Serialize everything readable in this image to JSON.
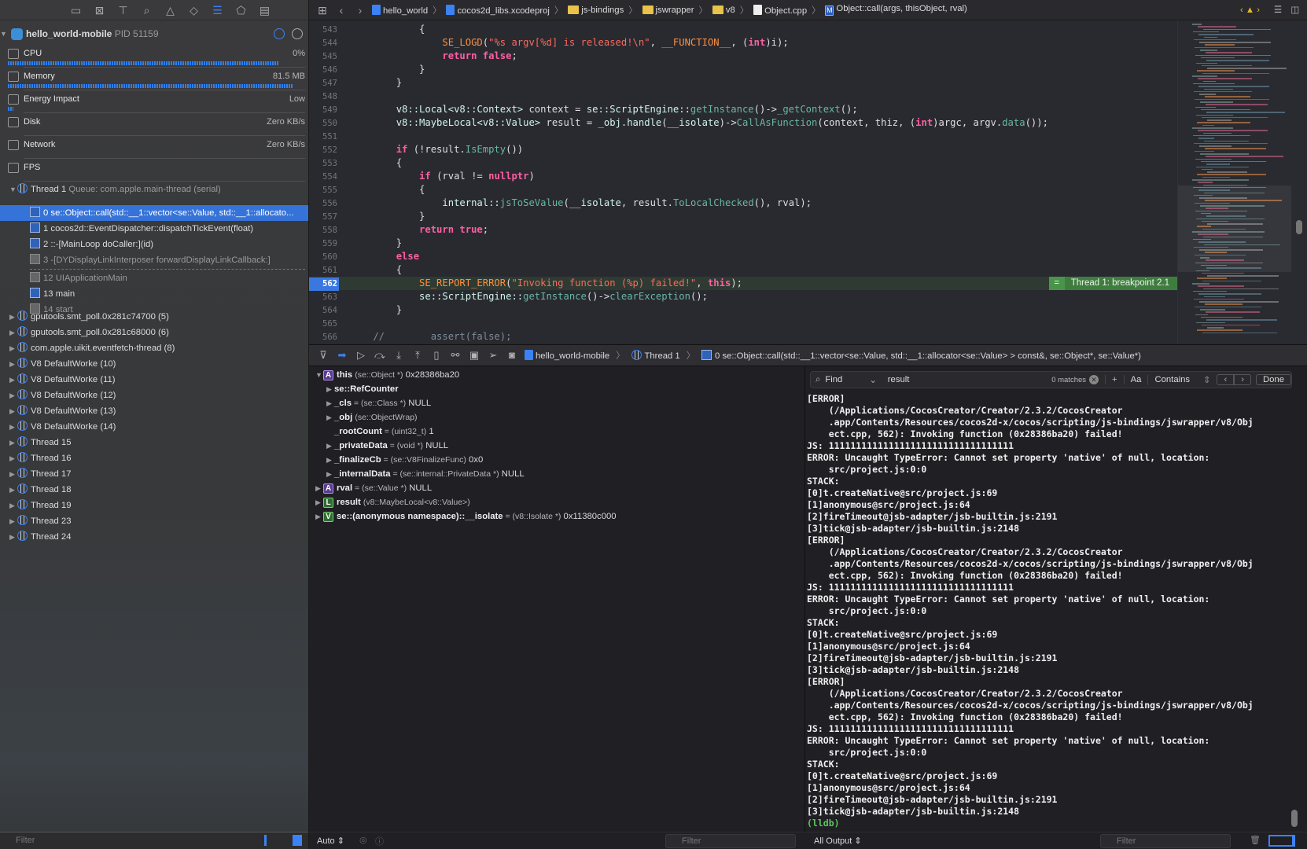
{
  "navigator": {
    "toolbar_icons": [
      "folder-icon",
      "source-control-icon",
      "hierarchy-icon",
      "search-icon",
      "warning-icon",
      "breakpoint-diamond-icon",
      "debug-navigator-icon",
      "tag-icon",
      "report-icon"
    ],
    "process": {
      "name": "hello_world-mobile",
      "pid": "PID 51159"
    },
    "gauges": [
      {
        "label": "CPU",
        "value": "0%",
        "level": 0.93
      },
      {
        "label": "Memory",
        "value": "81.5 MB",
        "level": 0.98
      },
      {
        "label": "Energy Impact",
        "value": "Low",
        "level": 0.02
      },
      {
        "label": "Disk",
        "value": "Zero KB/s"
      },
      {
        "label": "Network",
        "value": "Zero KB/s"
      },
      {
        "label": "FPS",
        "value": ""
      }
    ],
    "thread1": {
      "name": "Thread 1",
      "queue": "Queue: com.apple.main-thread (serial)"
    },
    "frames": [
      {
        "label": "0 se::Object::call(std::__1::vector<se::Value, std::__1::allocato...",
        "kind": "user",
        "selected": true
      },
      {
        "label": "1 cocos2d::EventDispatcher::dispatchTickEvent(float)",
        "kind": "user"
      },
      {
        "label": "2 ::-[MainLoop doCaller:](id)",
        "kind": "user"
      },
      {
        "label": "3 -[DYDisplayLinkInterposer forwardDisplayLinkCallback:]",
        "kind": "system"
      },
      {
        "label": "12 UIApplicationMain",
        "kind": "system"
      },
      {
        "label": "13 main",
        "kind": "user"
      },
      {
        "label": "14 start",
        "kind": "system"
      }
    ],
    "threads": [
      "gputools.smt_poll.0x281c74700 (5)",
      "gputools.smt_poll.0x281c68000 (6)",
      "com.apple.uikit.eventfetch-thread (8)",
      "V8 DefaultWorke (10)",
      "V8 DefaultWorke (11)",
      "V8 DefaultWorke (12)",
      "V8 DefaultWorke (13)",
      "V8 DefaultWorke (14)",
      "Thread 15",
      "Thread 16",
      "Thread 17",
      "Thread 18",
      "Thread 19",
      "Thread 23",
      "Thread 24"
    ],
    "filter_placeholder": "Filter"
  },
  "jumpbar": {
    "crumbs": [
      {
        "label": "hello_world",
        "icon": "project-icon"
      },
      {
        "label": "cocos2d_libs.xcodeproj",
        "icon": "project-icon"
      },
      {
        "label": "js-bindings",
        "icon": "folder-icon"
      },
      {
        "label": "jswrapper",
        "icon": "folder-icon"
      },
      {
        "label": "v8",
        "icon": "folder-icon"
      },
      {
        "label": "Object.cpp",
        "icon": "cpp-file-icon"
      },
      {
        "label": "Object::call(args, thisObject, rval)",
        "icon": "method-icon"
      }
    ]
  },
  "editor": {
    "current_line": 562,
    "breakpoint_label": "Thread 1: breakpoint 2.1",
    "lines": [
      {
        "n": 543,
        "t": [
          [
            "pl",
            "            {"
          ]
        ]
      },
      {
        "n": 544,
        "t": [
          [
            "mac",
            "                SE_LOGD"
          ],
          [
            "pl",
            "("
          ],
          [
            "str",
            "\"%s argv[%d] is released!\\n\""
          ],
          [
            "pl",
            ", "
          ],
          [
            "mac",
            "__FUNCTION__"
          ],
          [
            "pl",
            ", ("
          ],
          [
            "kw",
            "int"
          ],
          [
            "pl",
            ")i);"
          ]
        ]
      },
      {
        "n": 545,
        "t": [
          [
            "kw",
            "                return false"
          ],
          [
            "pl",
            ";"
          ]
        ]
      },
      {
        "n": 546,
        "t": [
          [
            "pl",
            "            }"
          ]
        ]
      },
      {
        "n": 547,
        "t": [
          [
            "pl",
            "        }"
          ]
        ]
      },
      {
        "n": 548,
        "t": []
      },
      {
        "n": 549,
        "t": [
          [
            "ty",
            "        v8::Local<v8::Context>"
          ],
          [
            "pl",
            " context = "
          ],
          [
            "ty",
            "se::ScriptEngine::"
          ],
          [
            "fn",
            "getInstance"
          ],
          [
            "pl",
            "()->"
          ],
          [
            "fn",
            "_getContext"
          ],
          [
            "pl",
            "();"
          ]
        ]
      },
      {
        "n": 550,
        "t": [
          [
            "ty",
            "        v8::MaybeLocal<v8::Value>"
          ],
          [
            "pl",
            " result = "
          ],
          [
            "ty",
            "_obj"
          ],
          [
            "pl",
            "."
          ],
          [
            "ty",
            "handle"
          ],
          [
            "pl",
            "("
          ],
          [
            "ty",
            "__isolate"
          ],
          [
            "pl",
            ")->"
          ],
          [
            "fn",
            "CallAsFunction"
          ],
          [
            "pl",
            "(context, thiz, ("
          ],
          [
            "kw",
            "int"
          ],
          [
            "pl",
            ")argc, argv."
          ],
          [
            "fn",
            "data"
          ],
          [
            "pl",
            "());"
          ]
        ]
      },
      {
        "n": 551,
        "t": []
      },
      {
        "n": 552,
        "t": [
          [
            "kw",
            "        if"
          ],
          [
            "pl",
            " (!result."
          ],
          [
            "fn",
            "IsEmpty"
          ],
          [
            "pl",
            "())"
          ]
        ]
      },
      {
        "n": 553,
        "t": [
          [
            "pl",
            "        {"
          ]
        ]
      },
      {
        "n": 554,
        "t": [
          [
            "kw",
            "            if"
          ],
          [
            "pl",
            " (rval != "
          ],
          [
            "kw",
            "nullptr"
          ],
          [
            "pl",
            ")"
          ]
        ]
      },
      {
        "n": 555,
        "t": [
          [
            "pl",
            "            {"
          ]
        ]
      },
      {
        "n": 556,
        "t": [
          [
            "ty",
            "                internal::"
          ],
          [
            "fn",
            "jsToSeValue"
          ],
          [
            "pl",
            "("
          ],
          [
            "ty",
            "__isolate"
          ],
          [
            "pl",
            ", result."
          ],
          [
            "fn",
            "ToLocalChecked"
          ],
          [
            "pl",
            "(), rval);"
          ]
        ]
      },
      {
        "n": 557,
        "t": [
          [
            "pl",
            "            }"
          ]
        ]
      },
      {
        "n": 558,
        "t": [
          [
            "kw",
            "            return true"
          ],
          [
            "pl",
            ";"
          ]
        ]
      },
      {
        "n": 559,
        "t": [
          [
            "pl",
            "        }"
          ]
        ]
      },
      {
        "n": 560,
        "t": [
          [
            "kw",
            "        else"
          ]
        ]
      },
      {
        "n": 561,
        "t": [
          [
            "pl",
            "        {"
          ]
        ]
      },
      {
        "n": 562,
        "t": [
          [
            "mac",
            "            SE_REPORT_ERROR"
          ],
          [
            "pl",
            "("
          ],
          [
            "str",
            "\"Invoking function (%p) failed!\""
          ],
          [
            "pl",
            ", "
          ],
          [
            "kw",
            "this"
          ],
          [
            "pl",
            ");"
          ]
        ]
      },
      {
        "n": 563,
        "t": [
          [
            "ty",
            "            se::ScriptEngine::"
          ],
          [
            "fn",
            "getInstance"
          ],
          [
            "pl",
            "()->"
          ],
          [
            "fn",
            "clearException"
          ],
          [
            "pl",
            "();"
          ]
        ]
      },
      {
        "n": 564,
        "t": [
          [
            "pl",
            "        }"
          ]
        ]
      },
      {
        "n": 565,
        "t": []
      },
      {
        "n": 566,
        "t": [
          [
            "cm",
            "    //        assert(false);"
          ]
        ]
      }
    ]
  },
  "debugbar": {
    "icons": [
      "hide-debug-area-icon",
      "breakpoints-toggle-icon",
      "continue-icon",
      "step-over-icon",
      "step-into-icon",
      "step-out-icon",
      "view-debugger-icon",
      "memory-graph-icon",
      "environment-overrides-icon",
      "location-icon",
      "camera-icon"
    ],
    "process": "hello_world-mobile",
    "thread": "Thread 1",
    "frame": "0 se::Object::call(std::__1::vector<se::Value, std::__1::allocator<se::Value> > const&, se::Object*, se::Value*)"
  },
  "variables": [
    {
      "depth": 0,
      "exp": "open",
      "badge": "A",
      "name": "this",
      "type": "(se::Object *)",
      "value": "0x28386ba20"
    },
    {
      "depth": 1,
      "exp": "closed",
      "name": "se::RefCounter",
      "type": "",
      "value": ""
    },
    {
      "depth": 1,
      "exp": "closed",
      "name": "_cls",
      "eq": true,
      "type": "(se::Class *)",
      "value": "NULL"
    },
    {
      "depth": 1,
      "exp": "closed",
      "name": "_obj",
      "type": "(se::ObjectWrap)",
      "value": ""
    },
    {
      "depth": 1,
      "exp": "none",
      "name": "_rootCount",
      "eq": true,
      "type": "(uint32_t)",
      "value": "1"
    },
    {
      "depth": 1,
      "exp": "closed",
      "name": "_privateData",
      "eq": true,
      "type": "(void *)",
      "value": "NULL"
    },
    {
      "depth": 1,
      "exp": "closed",
      "name": "_finalizeCb",
      "eq": true,
      "type": "(se::V8FinalizeFunc)",
      "value": "0x0"
    },
    {
      "depth": 1,
      "exp": "closed",
      "name": "_internalData",
      "eq": true,
      "type": "(se::internal::PrivateData *)",
      "value": "NULL"
    },
    {
      "depth": 0,
      "exp": "closed",
      "badge": "A",
      "name": "rval",
      "eq": true,
      "type": "(se::Value *)",
      "value": "NULL"
    },
    {
      "depth": 0,
      "exp": "closed",
      "badge": "L",
      "name": "result",
      "type": "(v8::MaybeLocal<v8::Value>)",
      "value": ""
    },
    {
      "depth": 0,
      "exp": "closed",
      "badge": "V",
      "name": "se::(anonymous namespace)::__isolate",
      "eq": true,
      "type": "(v8::Isolate *)",
      "value": "0x11380c000"
    }
  ],
  "find": {
    "mode": "Find",
    "query": "result",
    "matches": "0 matches",
    "case_label": "Aa",
    "match_type": "Contains",
    "done": "Done"
  },
  "console": {
    "lines": [
      "[ERROR]",
      "    (/Applications/CocosCreator/Creator/2.3.2/CocosCreator",
      "    .app/Contents/Resources/cocos2d-x/cocos/scripting/js-bindings/jswrapper/v8/Obj",
      "    ect.cpp, 562): Invoking function (0x28386ba20) failed!",
      "JS: 1111111111111111111111111111111111",
      "ERROR: Uncaught TypeError: Cannot set property 'native' of null, location:",
      "    src/project.js:0:0",
      "STACK:",
      "[0]t.createNative@src/project.js:69",
      "[1]anonymous@src/project.js:64",
      "[2]fireTimeout@jsb-adapter/jsb-builtin.js:2191",
      "[3]tick@jsb-adapter/jsb-builtin.js:2148",
      "[ERROR]",
      "    (/Applications/CocosCreator/Creator/2.3.2/CocosCreator",
      "    .app/Contents/Resources/cocos2d-x/cocos/scripting/js-bindings/jswrapper/v8/Obj",
      "    ect.cpp, 562): Invoking function (0x28386ba20) failed!",
      "JS: 1111111111111111111111111111111111",
      "ERROR: Uncaught TypeError: Cannot set property 'native' of null, location:",
      "    src/project.js:0:0",
      "STACK:",
      "[0]t.createNative@src/project.js:69",
      "[1]anonymous@src/project.js:64",
      "[2]fireTimeout@jsb-adapter/jsb-builtin.js:2191",
      "[3]tick@jsb-adapter/jsb-builtin.js:2148",
      "[ERROR]",
      "    (/Applications/CocosCreator/Creator/2.3.2/CocosCreator",
      "    .app/Contents/Resources/cocos2d-x/cocos/scripting/js-bindings/jswrapper/v8/Obj",
      "    ect.cpp, 562): Invoking function (0x28386ba20) failed!",
      "JS: 1111111111111111111111111111111111",
      "ERROR: Uncaught TypeError: Cannot set property 'native' of null, location:",
      "    src/project.js:0:0",
      "STACK:",
      "[0]t.createNative@src/project.js:69",
      "[1]anonymous@src/project.js:64",
      "[2]fireTimeout@jsb-adapter/jsb-builtin.js:2191",
      "[3]tick@jsb-adapter/jsb-builtin.js:2148"
    ],
    "prompt": "(lldb)"
  },
  "bottom": {
    "auto_label": "Auto",
    "filter_placeholder": "Filter",
    "output_label": "All Output"
  }
}
